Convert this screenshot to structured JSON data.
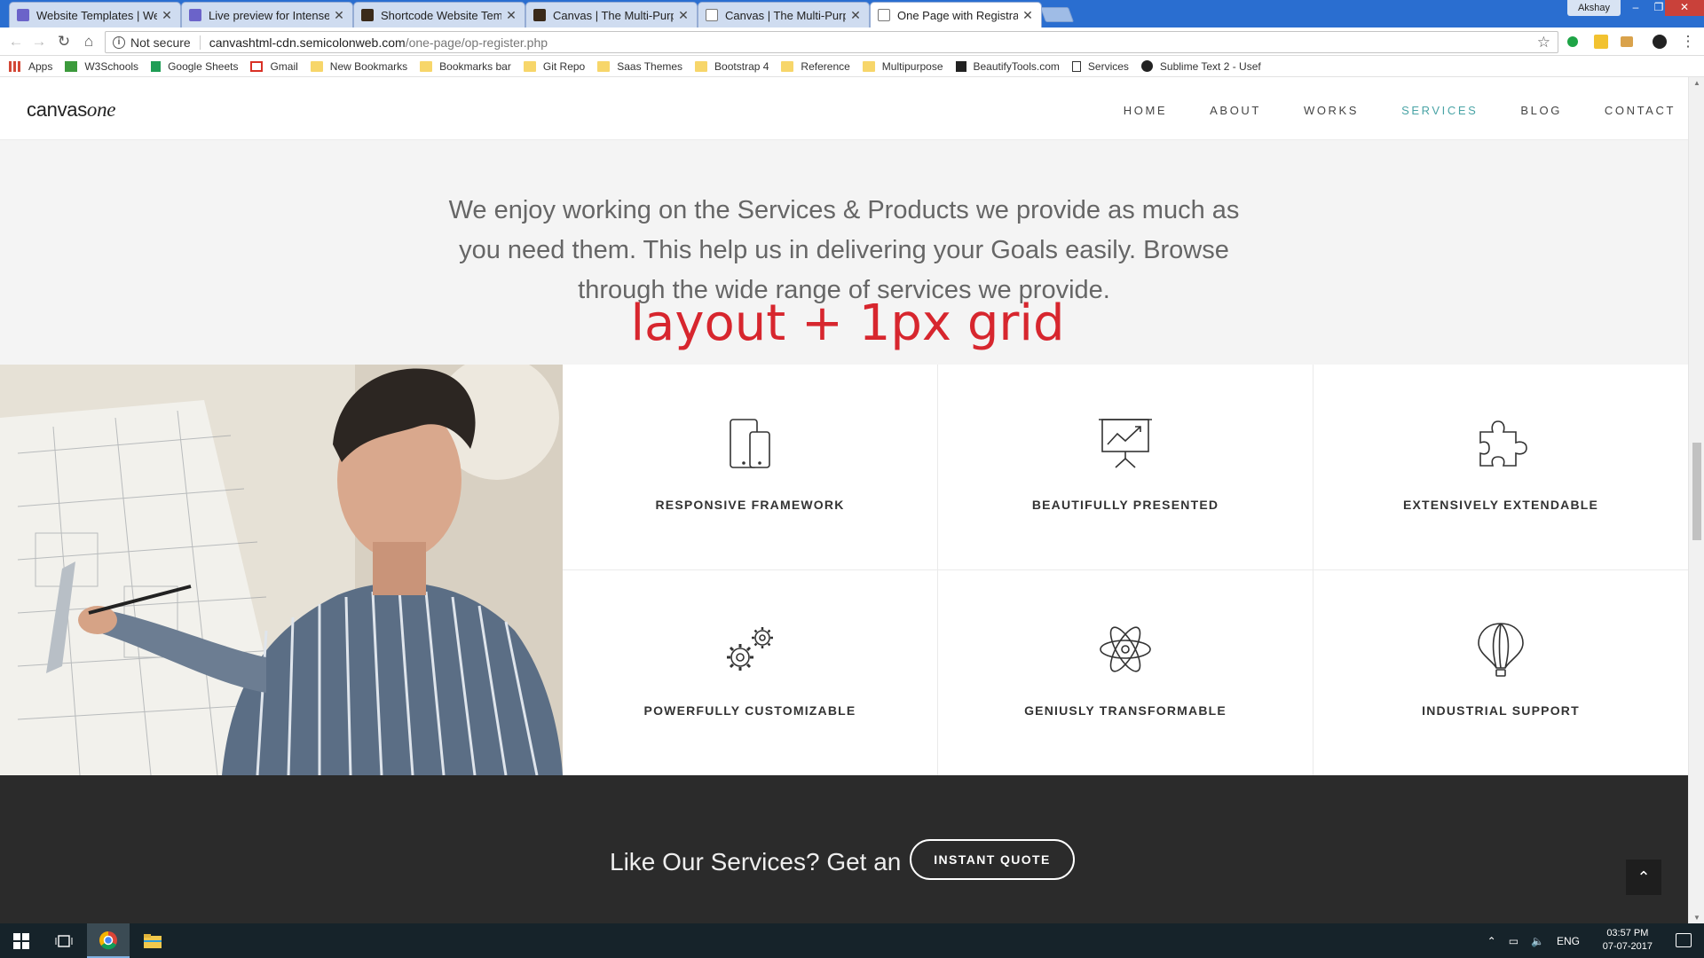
{
  "browser": {
    "tabs": [
      {
        "title": "Website Templates | Web",
        "active": false
      },
      {
        "title": "Live preview for Intense",
        "active": false
      },
      {
        "title": "Shortcode Website Temp",
        "active": false
      },
      {
        "title": "Canvas | The Multi-Purp",
        "active": false
      },
      {
        "title": "Canvas | The Multi-Purp",
        "active": false
      },
      {
        "title": "One Page with Registrati",
        "active": true
      }
    ],
    "profile_name": "Akshay",
    "security_label": "Not secure",
    "url_host": "canvashtml-cdn.semicolonweb.com",
    "url_path": "/one-page/op-register.php",
    "bookmarks": [
      "Apps",
      "W3Schools",
      "Google Sheets",
      "Gmail",
      "New Bookmarks",
      "Bookmarks bar",
      "Git Repo",
      "Saas Themes",
      "Bootstrap 4",
      "Reference",
      "Multipurpose",
      "BeautifyTools.com",
      "Services",
      "Sublime Text 2 - Usef"
    ]
  },
  "site": {
    "logo_main": "canvas",
    "logo_accent": "one",
    "nav": [
      "HOME",
      "ABOUT",
      "WORKS",
      "SERVICES",
      "BLOG",
      "CONTACT"
    ],
    "nav_active": "SERVICES",
    "accent_color": "#4aa4a6",
    "intro": "We enjoy working on the Services & Products we provide as much as you need them. This help us in delivering your Goals easily. Browse through the wide range of services we provide.",
    "overlay_note": "layout + 1px grid",
    "services": [
      {
        "label": "RESPONSIVE FRAMEWORK",
        "icon": "devices-icon"
      },
      {
        "label": "BEAUTIFULLY PRESENTED",
        "icon": "presentation-icon"
      },
      {
        "label": "EXTENSIVELY EXTENDABLE",
        "icon": "puzzle-icon"
      },
      {
        "label": "POWERFULLY CUSTOMIZABLE",
        "icon": "gears-icon"
      },
      {
        "label": "GENIUSLY TRANSFORMABLE",
        "icon": "atom-icon"
      },
      {
        "label": "INDUSTRIAL SUPPORT",
        "icon": "balloon-icon"
      }
    ],
    "cta_text": "Like Our Services? Get an",
    "cta_button": "INSTANT QUOTE"
  },
  "taskbar": {
    "language": "ENG",
    "time": "03:57 PM",
    "date": "07-07-2017"
  }
}
